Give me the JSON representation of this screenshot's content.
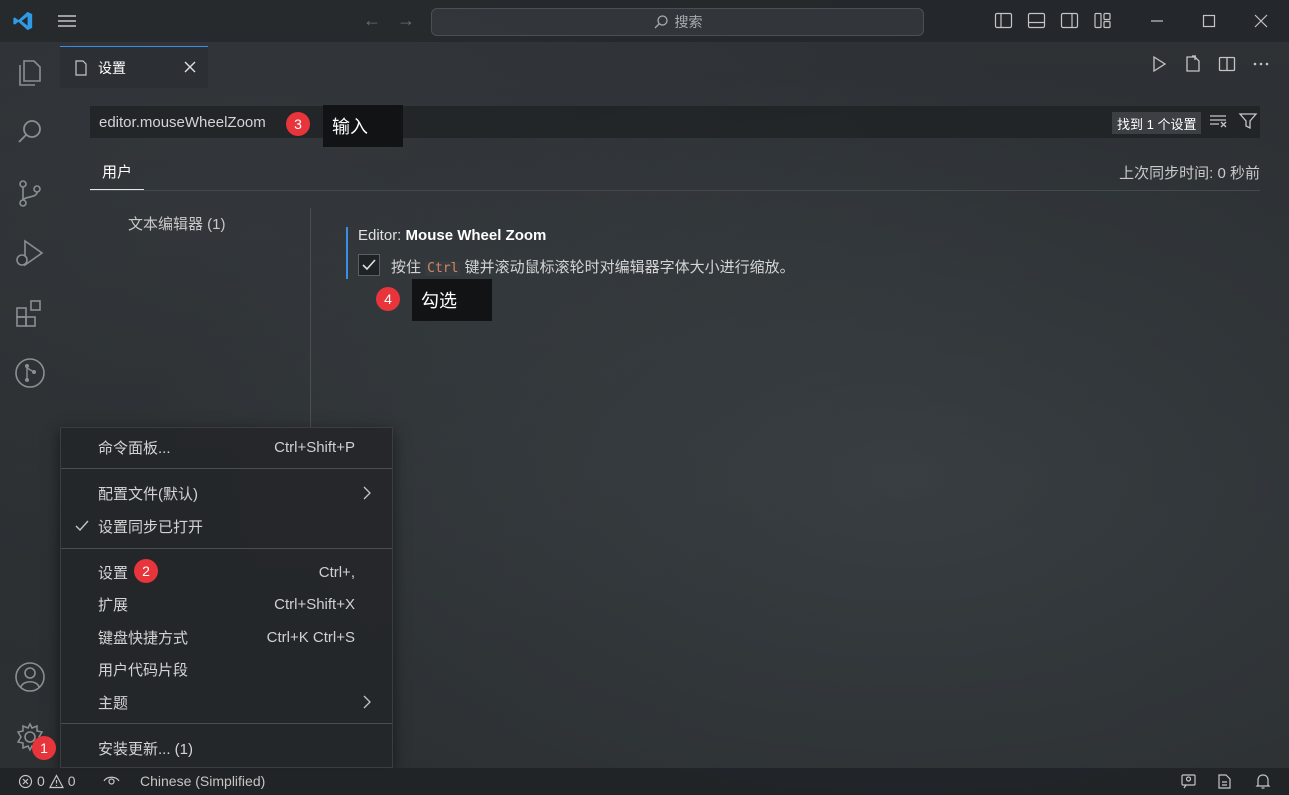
{
  "titlebar": {
    "search_label": "搜索",
    "icons": [
      "vscode-logo-icon",
      "hamburger-menu-icon",
      "back-arrow-icon",
      "forward-arrow-icon",
      "search-icon",
      "toggle-primary-sidebar-icon",
      "toggle-panel-icon",
      "toggle-secondary-sidebar-icon",
      "customize-layout-icon",
      "minimize-icon",
      "maximize-icon",
      "close-icon"
    ]
  },
  "activitybar": {
    "items": [
      "explorer-icon",
      "search-icon",
      "source-control-icon",
      "run-debug-icon",
      "extensions-icon",
      "git-graph-icon"
    ],
    "bottom": [
      "accounts-icon",
      "manage-gear-icon"
    ]
  },
  "tab": {
    "label": "设置"
  },
  "settings": {
    "search_value": "editor.mouseWheelZoom",
    "found_label": "找到 1 个设置",
    "scope_tab": "用户",
    "sync_time": "上次同步时间: 0 秒前",
    "toc_item": "文本编辑器 (1)",
    "setting_title_prefix": "Editor: ",
    "setting_title_name": "Mouse Wheel Zoom",
    "desc_before": "按住 ",
    "desc_code": "Ctrl",
    "desc_after": " 键并滚动鼠标滚轮时对编辑器字体大小进行缩放。",
    "checked": true
  },
  "annotations": {
    "step1": "1",
    "step2": "2",
    "step3": "3",
    "step3_text": "输入",
    "step4": "4",
    "step4_text": "勾选"
  },
  "context_menu": {
    "command_palette": {
      "label": "命令面板...",
      "key": "Ctrl+Shift+P"
    },
    "profile": {
      "label": "配置文件(默认)"
    },
    "sync": {
      "label": "设置同步已打开"
    },
    "settings": {
      "label": "设置",
      "key": "Ctrl+,"
    },
    "extensions": {
      "label": "扩展",
      "key": "Ctrl+Shift+X"
    },
    "keyboard": {
      "label": "键盘快捷方式",
      "key": "Ctrl+K Ctrl+S"
    },
    "snippets": {
      "label": "用户代码片段"
    },
    "theme": {
      "label": "主题"
    },
    "update": {
      "label": "安装更新... (1)"
    }
  },
  "statusbar": {
    "errors": "0",
    "warnings": "0",
    "language": "Chinese (Simplified)"
  },
  "colors": {
    "accent": "#3a8ee6",
    "badge_red": "#e8343b",
    "code_color": "#d7875f"
  }
}
